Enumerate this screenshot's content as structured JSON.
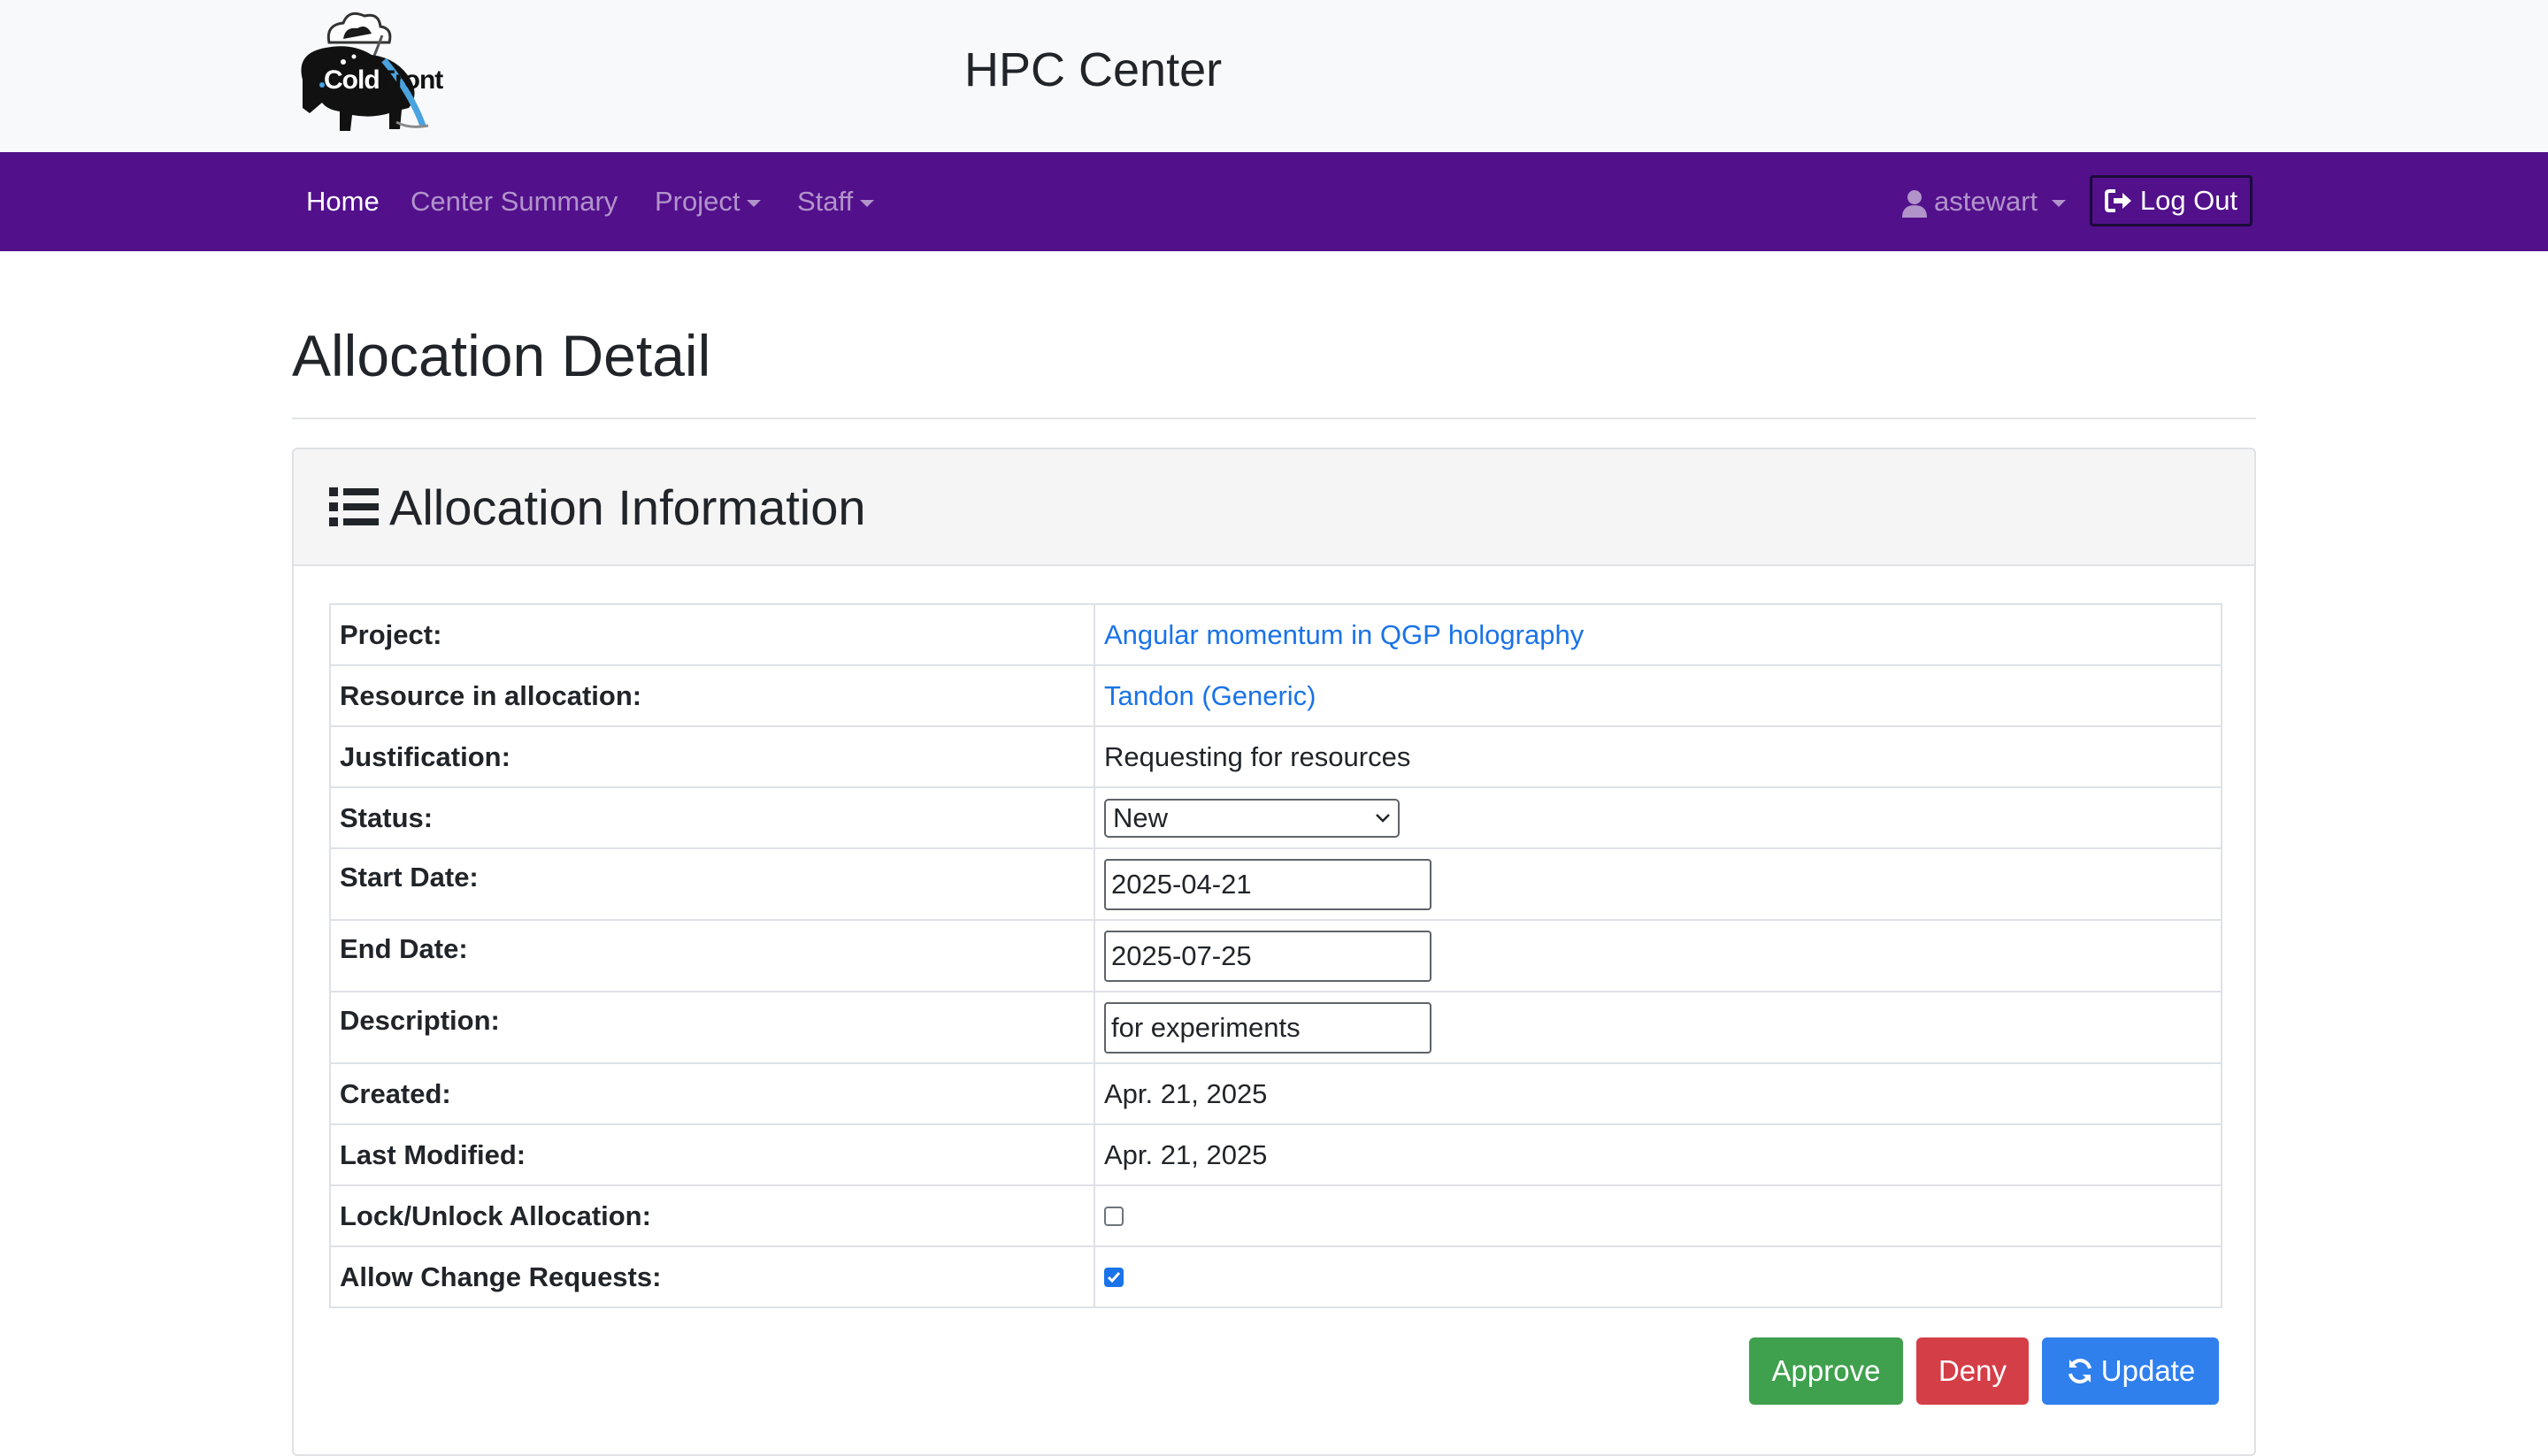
{
  "header": {
    "logo_word_cold": "Cold",
    "logo_word_front": "Front",
    "center_title": "HPC Center"
  },
  "nav": {
    "items": [
      {
        "label": "Home",
        "active": true
      },
      {
        "label": "Center Summary"
      },
      {
        "label": "Project",
        "dropdown": true
      },
      {
        "label": "Staff",
        "dropdown": true
      }
    ],
    "user": "astewart",
    "logout": "Log Out",
    "colors": {
      "navbar": "#52108b",
      "active_link": "#ffffff"
    }
  },
  "page": {
    "title": "Allocation Detail",
    "card_title": "Allocation Information"
  },
  "details": {
    "project_label": "Project:",
    "project_value": "Angular momentum in QGP holography",
    "resource_label": "Resource in allocation:",
    "resource_value": "Tandon (Generic)",
    "justification_label": "Justification:",
    "justification_value": "Requesting for resources",
    "status_label": "Status:",
    "status_value": "New",
    "start_label": "Start Date:",
    "start_value": "2025-04-21",
    "end_label": "End Date:",
    "end_value": "2025-07-25",
    "description_label": "Description:",
    "description_value": "for experiments",
    "created_label": "Created:",
    "created_value": "Apr. 21, 2025",
    "modified_label": "Last Modified:",
    "modified_value": "Apr. 21, 2025",
    "lock_label": "Lock/Unlock Allocation:",
    "lock_checked": false,
    "change_label": "Allow Change Requests:",
    "change_checked": true
  },
  "actions": {
    "approve": "Approve",
    "deny": "Deny",
    "update": "Update",
    "colors": {
      "approve": "#3fa04e",
      "deny": "#d43f47",
      "update": "#2f80ed"
    }
  }
}
